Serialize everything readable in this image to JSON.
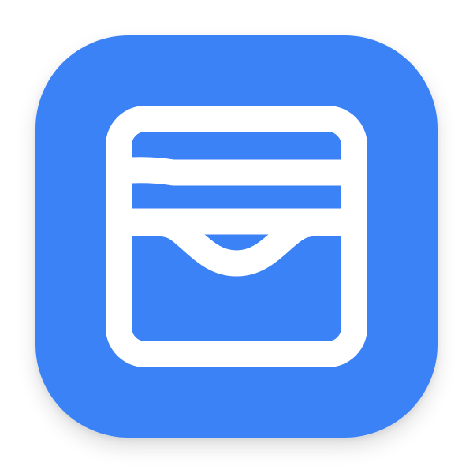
{
  "icon": {
    "name": "wallet-icon",
    "background_color": "#3B82F6",
    "glyph_color": "#FFFFFF",
    "shadow": true
  }
}
